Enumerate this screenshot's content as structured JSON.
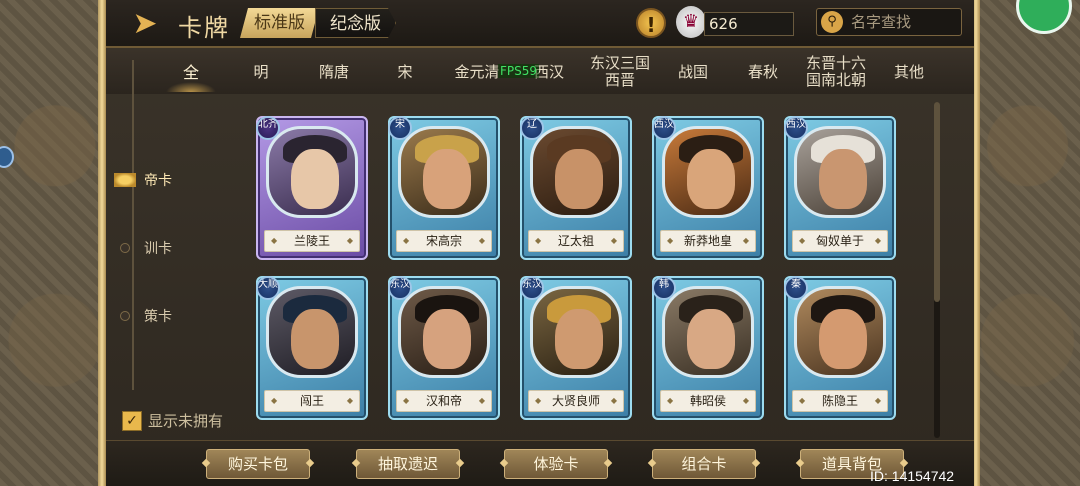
{
  "header": {
    "title": "卡牌",
    "version_tabs": [
      {
        "label": "标准版",
        "active": true
      },
      {
        "label": "纪念版",
        "active": false
      }
    ],
    "currency_amount": "626",
    "search_placeholder": "名字查找"
  },
  "dynasty_tabs": [
    {
      "label": "全",
      "active": true
    },
    {
      "label": "明"
    },
    {
      "label": "隋唐"
    },
    {
      "label": "宋"
    },
    {
      "label": "金元清"
    },
    {
      "label": "西汉"
    },
    {
      "label": "东汉三国\n西晋"
    },
    {
      "label": "战国"
    },
    {
      "label": "春秋"
    },
    {
      "label": "东晋十六\n国南北朝"
    },
    {
      "label": "其他"
    }
  ],
  "fps_label": "FPS59",
  "categories": [
    {
      "label": "帝卡",
      "active": true
    },
    {
      "label": "训卡"
    },
    {
      "label": "策卡"
    }
  ],
  "show_unowned": {
    "label": "显示未拥有",
    "checked": true
  },
  "cards": [
    {
      "name": "兰陵王",
      "badge": "北齐",
      "rarity": "purple"
    },
    {
      "name": "宋高宗",
      "badge": "宋",
      "rarity": "blue"
    },
    {
      "name": "辽太祖",
      "badge": "辽",
      "rarity": "blue"
    },
    {
      "name": "新莽地皇",
      "badge": "西汉",
      "rarity": "blue"
    },
    {
      "name": "匈奴单于",
      "badge": "西汉",
      "rarity": "blue"
    },
    {
      "name": "闯王",
      "badge": "大顺",
      "rarity": "blue"
    },
    {
      "name": "汉和帝",
      "badge": "东汉",
      "rarity": "blue"
    },
    {
      "name": "大贤良师",
      "badge": "东汉",
      "rarity": "blue"
    },
    {
      "name": "韩昭侯",
      "badge": "韩",
      "rarity": "blue"
    },
    {
      "name": "陈隐王",
      "badge": "秦",
      "rarity": "blue"
    }
  ],
  "bottom_buttons": [
    "购买卡包",
    "抽取遗迟",
    "体验卡",
    "组合卡",
    "道具背包"
  ],
  "user_id": "ID: 14154742",
  "colors": {
    "accent_gold": "#e4b354",
    "card_blue": "#7ecbe4",
    "card_purple": "#b49ae6",
    "frame_dark": "#2e2820"
  },
  "icons": {
    "back": "arrow-left-icon",
    "warning": "exclamation-icon",
    "currency": "crane-coin-icon",
    "search": "magnifier-icon"
  }
}
